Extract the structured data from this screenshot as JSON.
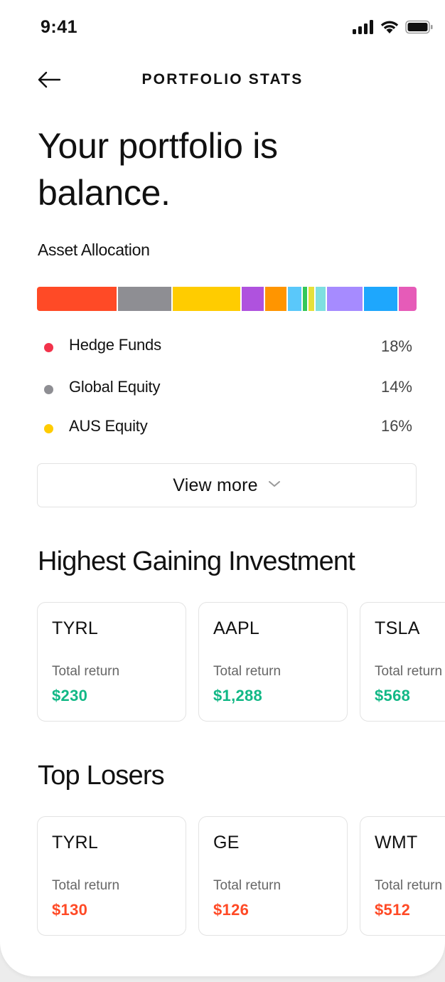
{
  "status_bar": {
    "time": "9:41",
    "signal_icon": "signal-bars-icon",
    "wifi_icon": "wifi-icon",
    "battery_icon": "battery-icon"
  },
  "header": {
    "back_icon": "arrow-left-icon",
    "title": "PORTFOLIO STATS"
  },
  "headline": "Your portfolio is balance.",
  "allocation": {
    "label": "Asset Allocation",
    "segments_pct": [
      {
        "color": "#FF4A26",
        "share": 21.4
      },
      {
        "color": "#8E8E93",
        "share": 14.3
      },
      {
        "color": "#FFCC00",
        "share": 18.2
      },
      {
        "color": "#AF52DE",
        "share": 6.2
      },
      {
        "color": "#FF9500",
        "share": 6.0
      },
      {
        "color": "#5AC8FA",
        "share": 3.9
      },
      {
        "color": "#34C759",
        "share": 1.5
      },
      {
        "color": "#E6E03A",
        "share": 2.0
      },
      {
        "color": "#7EDFE0",
        "share": 3.0
      },
      {
        "color": "#A68BFF",
        "share": 9.7
      },
      {
        "color": "#1EA7FD",
        "share": 9.2
      },
      {
        "color": "#E65BB8",
        "share": 4.6
      }
    ],
    "legend": [
      {
        "name": "Hedge Funds",
        "percent": "18%",
        "color": "#F2334B"
      },
      {
        "name": "Global Equity",
        "percent": "14%",
        "color": "#8E8E93"
      },
      {
        "name": "AUS Equity",
        "percent": "16%",
        "color": "#FFCC00"
      }
    ],
    "view_more_label": "View more",
    "view_more_icon": "chevron-down-icon"
  },
  "gainers": {
    "title": "Highest Gaining Investment",
    "value_color": "#12B886",
    "cards": [
      {
        "ticker": "TYRL",
        "label": "Total return",
        "value": "$230"
      },
      {
        "ticker": "AAPL",
        "label": "Total return",
        "value": "$1,288"
      },
      {
        "ticker": "TSLA",
        "label": "Total return",
        "value": "$568"
      }
    ]
  },
  "losers": {
    "title": "Top Losers",
    "value_color": "#FF4A26",
    "cards": [
      {
        "ticker": "TYRL",
        "label": "Total return",
        "value": "$130"
      },
      {
        "ticker": "GE",
        "label": "Total return",
        "value": "$126"
      },
      {
        "ticker": "WMT",
        "label": "Total return",
        "value": "$512"
      }
    ]
  }
}
